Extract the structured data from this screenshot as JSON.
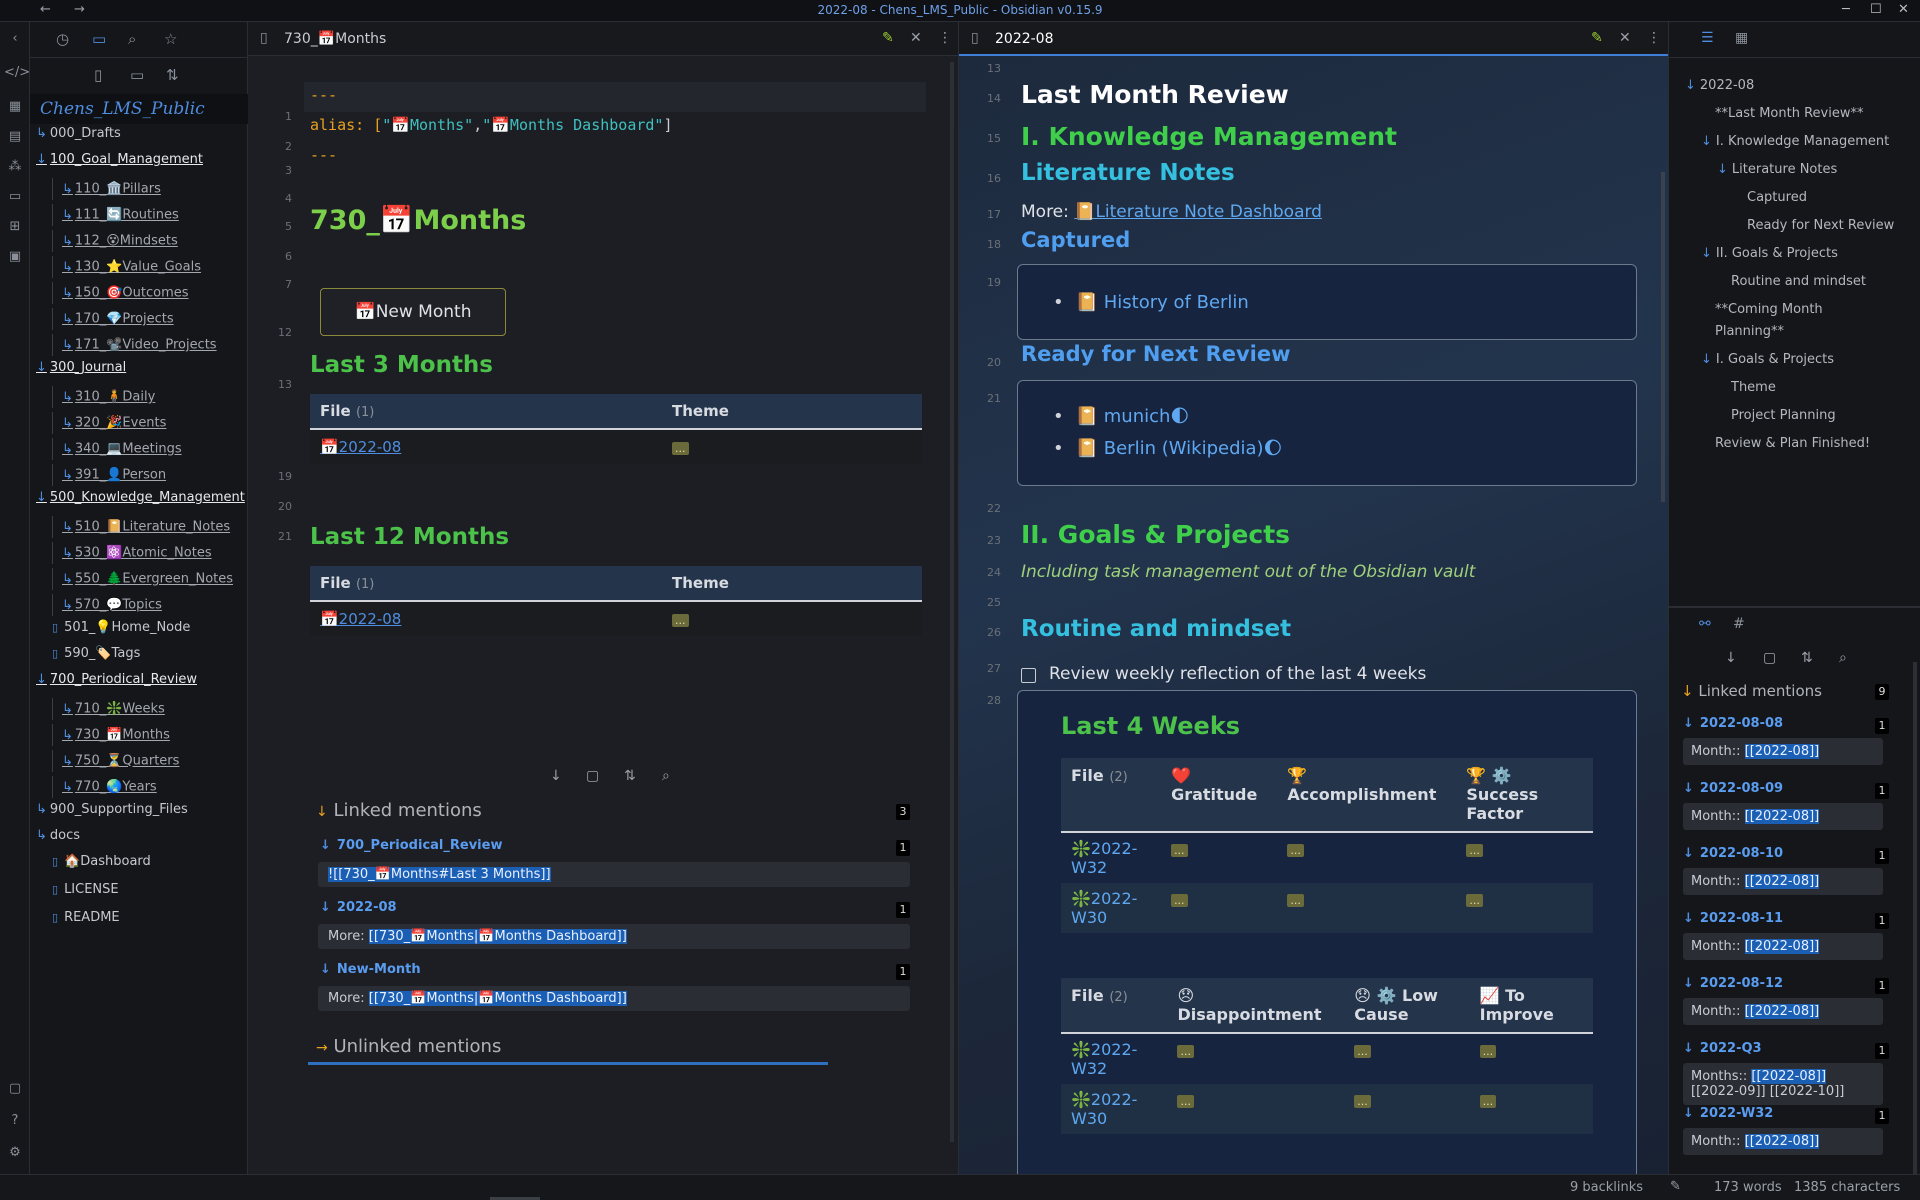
{
  "window": {
    "title": "2022-08 - Chens_LMS_Public - Obsidian v0.15.9"
  },
  "vault": {
    "name": "Chens_LMS_Public"
  },
  "tree": [
    {
      "label": "000_Drafts",
      "type": "folder"
    },
    {
      "label": "100_Goal_Management",
      "type": "open"
    },
    {
      "label": "110_🏛️Pillars",
      "type": "sub"
    },
    {
      "label": "111_🔄Routines",
      "type": "sub"
    },
    {
      "label": "112_😵Mindsets",
      "type": "sub"
    },
    {
      "label": "130_⭐Value_Goals",
      "type": "sub"
    },
    {
      "label": "150_🎯Outcomes",
      "type": "sub"
    },
    {
      "label": "170_💎Projects",
      "type": "sub"
    },
    {
      "label": "171_📽️Video_Projects",
      "type": "sub"
    },
    {
      "label": "300_Journal",
      "type": "open"
    },
    {
      "label": "310_🧍Daily",
      "type": "sub"
    },
    {
      "label": "320_🎉Events",
      "type": "sub"
    },
    {
      "label": "340_💻Meetings",
      "type": "sub"
    },
    {
      "label": "391_👤Person",
      "type": "sub"
    },
    {
      "label": "500_Knowledge_Management",
      "type": "open"
    },
    {
      "label": "510_📔Literature_Notes",
      "type": "sub"
    },
    {
      "label": "530_⚛️Atomic_Notes",
      "type": "sub"
    },
    {
      "label": "550_🌲Evergreen_Notes",
      "type": "sub"
    },
    {
      "label": "570_💬Topics",
      "type": "sub"
    },
    {
      "label": "501_💡Home_Node",
      "type": "file"
    },
    {
      "label": "590_🏷️Tags",
      "type": "file"
    },
    {
      "label": "700_Periodical_Review",
      "type": "open"
    },
    {
      "label": "710_❇️Weeks",
      "type": "sub"
    },
    {
      "label": "730_📅Months",
      "type": "sub"
    },
    {
      "label": "750_⏳Quarters",
      "type": "sub"
    },
    {
      "label": "770_🌏Years",
      "type": "sub"
    },
    {
      "label": "900_Supporting_Files",
      "type": "folder"
    },
    {
      "label": "docs",
      "type": "folder"
    },
    {
      "label": "🏠Dashboard",
      "type": "file"
    },
    {
      "label": "LICENSE",
      "type": "file"
    },
    {
      "label": "README",
      "type": "file"
    }
  ],
  "left_pane": {
    "tab_title": "730_📅Months",
    "line_numbers": [
      "1",
      "2",
      "3",
      "4",
      "5",
      "6",
      "7",
      "12",
      "13",
      "19",
      "20",
      "21"
    ],
    "frontmatter_open": "---",
    "alias_key": "alias: [",
    "alias_val1": "\"📅Months\"",
    "alias_comma": ",",
    "alias_val2": "\"📅Months Dashboard\"",
    "alias_close": "]",
    "frontmatter_close": "---",
    "heading": "730_📅Months",
    "new_button": "📅New Month",
    "section1": "Last 3 Months",
    "section2": "Last 12 Months",
    "table_col_file": "File",
    "table_count": "(1)",
    "table_col_theme": "Theme",
    "table_row_file": "📅2022-08",
    "table_row_theme": "...",
    "linked_mentions": "Linked mentions",
    "linked_count": "3",
    "unlinked_mentions": "Unlinked mentions",
    "mentions": [
      {
        "title": "700_Periodical_Review",
        "count": "1",
        "prefix": "",
        "link": "![[730_📅Months#Last 3 Months]]"
      },
      {
        "title": "2022-08",
        "count": "1",
        "prefix": "More: ",
        "link": "[[730_📅Months|📅Months Dashboard]]"
      },
      {
        "title": "New-Month",
        "count": "1",
        "prefix": "More: ",
        "link": "[[730_📅Months|📅Months Dashboard]]"
      }
    ]
  },
  "right_pane": {
    "tab_title": "2022-08",
    "line_numbers": [
      "13",
      "14",
      "15",
      "16",
      "17",
      "18",
      "19",
      "20",
      "21",
      "22",
      "23",
      "24",
      "25",
      "26",
      "27",
      "28"
    ],
    "h_review": "Last Month Review",
    "h_km": "I. Knowledge Management",
    "h_lit": "Literature Notes",
    "more_label": "More: ",
    "more_link": "📔Literature Note Dashboard",
    "h_captured": "Captured",
    "captured_item": "📔 History of Berlin",
    "h_ready": "Ready for Next Review",
    "ready_item1": "📔 munich🌓",
    "ready_item2": "📔 Berlin (Wikipedia)🌔",
    "h_goals": "II. Goals & Projects",
    "goals_note": "Including task management out of the Obsidian vault",
    "h_routine": "Routine and mindset",
    "task": "Review weekly reflection of the last 4 weeks",
    "h_last4": "Last 4 Weeks",
    "t1_headers": [
      "File",
      "❤️ Gratitude",
      "🏆 Accomplishment",
      "🏆 ⚙️ Success Factor"
    ],
    "t1_count": "(2)",
    "t2_headers": [
      "File",
      "😞 Disappointment",
      "😞 ⚙️ Low Cause",
      "📈 To Improve"
    ],
    "t2_count": "(2)",
    "week_a": "❇️2022-W32",
    "week_b": "❇️2022-W30",
    "cell": "..."
  },
  "outline": [
    {
      "label": "2022-08",
      "indent": 0,
      "arrow": true
    },
    {
      "label": "**Last Month Review**",
      "indent": 1,
      "arrow": false
    },
    {
      "label": "I. Knowledge Management",
      "indent": 1,
      "arrow": true
    },
    {
      "label": "Literature Notes",
      "indent": 2,
      "arrow": true
    },
    {
      "label": "Captured",
      "indent": 3,
      "arrow": false
    },
    {
      "label": "Ready for Next Review",
      "indent": 3,
      "arrow": false
    },
    {
      "label": "II. Goals & Projects",
      "indent": 1,
      "arrow": true
    },
    {
      "label": "Routine and mindset",
      "indent": 2,
      "arrow": false
    },
    {
      "label": "**Coming Month",
      "indent": 1,
      "arrow": false
    },
    {
      "label": "Planning**",
      "indent": 1,
      "arrow": false
    },
    {
      "label": "I. Goals & Projects",
      "indent": 1,
      "arrow": true
    },
    {
      "label": "Theme",
      "indent": 2,
      "arrow": false
    },
    {
      "label": "Project Planning",
      "indent": 2,
      "arrow": false
    },
    {
      "label": "Review & Plan Finished!",
      "indent": 1,
      "arrow": false
    }
  ],
  "backlinks_panel": {
    "title": "Linked mentions",
    "count": "9",
    "items": [
      {
        "date": "2022-08-08",
        "count": "1",
        "text": "Month:: ",
        "link": "[[2022-08]]"
      },
      {
        "date": "2022-08-09",
        "count": "1",
        "text": "Month:: ",
        "link": "[[2022-08]]"
      },
      {
        "date": "2022-08-10",
        "count": "1",
        "text": "Month:: ",
        "link": "[[2022-08]]"
      },
      {
        "date": "2022-08-11",
        "count": "1",
        "text": "Month:: ",
        "link": "[[2022-08]]"
      },
      {
        "date": "2022-08-12",
        "count": "1",
        "text": "Month:: ",
        "link": "[[2022-08]]"
      },
      {
        "date": "2022-Q3",
        "count": "1",
        "text": "Months:: ",
        "link": "[[2022-08]]",
        "extra": " [[2022-09]] [[2022-10]]"
      },
      {
        "date": "2022-W32",
        "count": "1",
        "text": "Month:: ",
        "link": "[[2022-08]]"
      }
    ]
  },
  "status": {
    "backlinks": "9 backlinks",
    "words": "173 words",
    "chars": "1385 characters"
  }
}
